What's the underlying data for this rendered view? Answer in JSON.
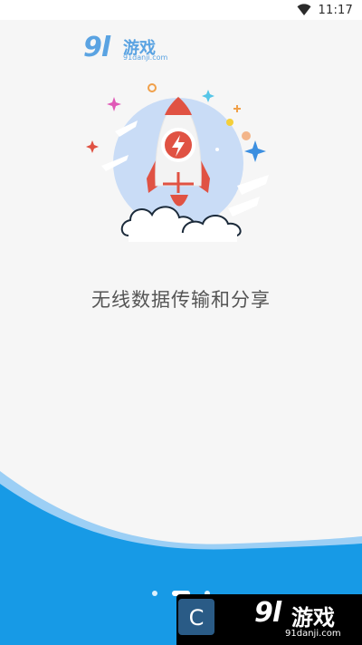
{
  "status_bar": {
    "time": "11:17",
    "wifi_icon": "wifi-icon"
  },
  "logo_top": {
    "number": "9l",
    "text": "游戏",
    "domain": "91danji.com"
  },
  "illustration": {
    "icon": "rocket-icon",
    "colors": {
      "circle": "#c9dcf6",
      "rocket_body": "#f3f3f3",
      "rocket_accent": "#e05243",
      "cloud_outline": "#1b2a3a",
      "star_blue": "#3c8fe0",
      "star_pink": "#e05ab7"
    }
  },
  "tagline": "无线数据传输和分享",
  "pager": {
    "total": 3,
    "active_index": 1
  },
  "watermark": {
    "badge_letter": "C",
    "number": "9l",
    "text": "游戏",
    "domain": "91danji.com"
  },
  "colors": {
    "background": "#f6f6f6",
    "wave_light": "#9ccff5",
    "wave_main": "#179ae6"
  }
}
